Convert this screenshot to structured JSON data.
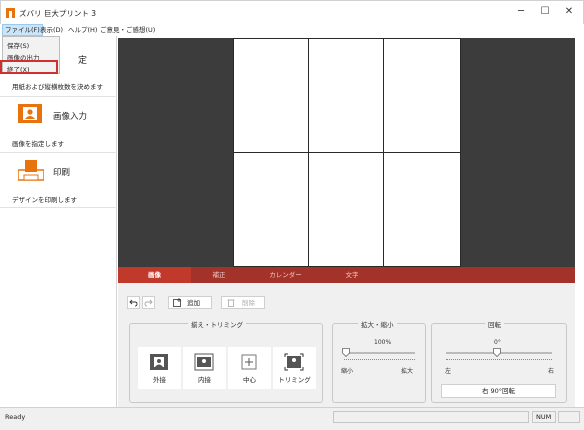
{
  "window": {
    "title": "ズバリ 巨大プリント 3"
  },
  "window_controls": {
    "minimize": "─",
    "maximize": "☐",
    "close": "✕"
  },
  "menubar": [
    {
      "label": "ファイル(F)"
    },
    {
      "label": "表示(D)"
    },
    {
      "label": "ヘルプ(H)"
    },
    {
      "label": "ご意見・ご感想(U)"
    }
  ],
  "file_menu": {
    "items": [
      "保存(S)",
      "画像の出力",
      "終了(X)"
    ]
  },
  "sidebar": {
    "partial_glyph": "定",
    "paper_desc": "用紙および縦横枚数を決めます",
    "image_title": "画像入力",
    "image_desc": "画像を指定します",
    "print_title": "印刷",
    "print_desc": "デザインを印刷します"
  },
  "tabs": [
    {
      "label": "画像",
      "active": true
    },
    {
      "label": "補正",
      "active": false
    },
    {
      "label": "カレンダー",
      "active": false
    },
    {
      "label": "文字",
      "active": false
    }
  ],
  "toolbar": {
    "add_label": "追加",
    "delete_label": "削除"
  },
  "trim": {
    "title": "揃え・トリミング",
    "buttons": [
      "外接",
      "内接",
      "中心",
      "トリミング"
    ]
  },
  "zoom": {
    "title": "拡大・縮小",
    "value": "100%",
    "min_label": "縮小",
    "max_label": "拡大"
  },
  "rotation": {
    "title": "回転",
    "value": "0°",
    "left_label": "左",
    "right_label": "右",
    "rotate90_label": "右 90°回転"
  },
  "status": {
    "text": "Ready",
    "num": "NUM"
  },
  "colors": {
    "accent": "#c0392b",
    "tab_bar": "#a3322a",
    "canvas": "#3c3c3c",
    "highlight": "#d32f2f",
    "icon_orange": "#e8730c"
  }
}
